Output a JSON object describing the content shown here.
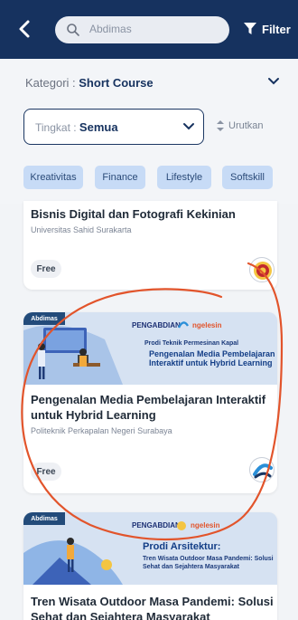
{
  "header": {
    "search_value": "Abdimas",
    "filter_label": "Filter",
    "bar_color": "#16325f"
  },
  "filters": {
    "kategori_label": "Kategori : ",
    "kategori_value": "Short Course",
    "tingkat_label": "Tingkat : ",
    "tingkat_value": "Semua",
    "sort_label": "Urutkan"
  },
  "chips": [
    {
      "label": "Kreativitas"
    },
    {
      "label": "Finance"
    },
    {
      "label": "Lifestyle"
    },
    {
      "label": "Softskill"
    }
  ],
  "courses": [
    {
      "title": "Bisnis Digital dan Fotografi Kekinian",
      "institution": "Universitas Sahid Surakarta",
      "price": "Free"
    },
    {
      "tag": "Abdimas",
      "banner_brand_left": "PENGABDIAN",
      "banner_brand_right": "ngelesin",
      "banner_prodi": "Prodi Teknik Permesinan Kapal",
      "banner_headline": "Pengenalan Media Pembelajaran Interaktif untuk Hybrid Learning",
      "title": "Pengenalan Media Pembelajaran Interaktif untuk Hybrid Learning",
      "institution": "Politeknik Perkapalan Negeri Surabaya",
      "price": "Free"
    },
    {
      "tag": "Abdimas",
      "banner_brand_left": "PENGABDIAN",
      "banner_brand_right": "ngelesin",
      "banner_prodi": "Prodi Arsitektur:",
      "banner_headline": "Tren Wisata Outdoor Masa Pandemi: Solusi Sehat dan Sejahtera Masyarakat",
      "title": "Tren Wisata Outdoor Masa Pandemi: Solusi Sehat dan Sejahtera Masyarakat"
    }
  ],
  "colors": {
    "chip_bg": "#c7dbf6",
    "annotation": "#e2542b"
  }
}
